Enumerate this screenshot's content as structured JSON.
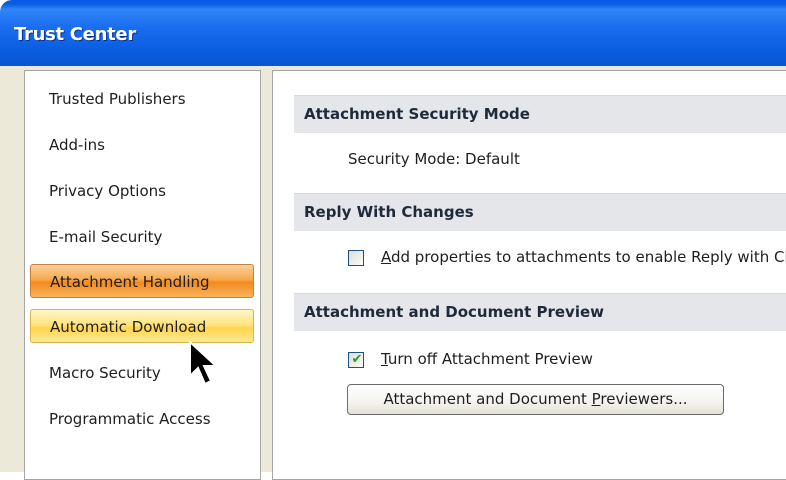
{
  "window": {
    "title": "Trust Center"
  },
  "sidebar": {
    "items": [
      {
        "label": "Trusted Publishers",
        "state": "normal"
      },
      {
        "label": "Add-ins",
        "state": "normal"
      },
      {
        "label": "Privacy Options",
        "state": "normal"
      },
      {
        "label": "E-mail Security",
        "state": "normal"
      },
      {
        "label": "Attachment Handling",
        "state": "selected"
      },
      {
        "label": "Automatic Download",
        "state": "hover"
      },
      {
        "label": "Macro Security",
        "state": "normal"
      },
      {
        "label": "Programmatic Access",
        "state": "normal"
      }
    ]
  },
  "main": {
    "security_mode": {
      "header": "Attachment Security Mode",
      "text": "Security Mode: Default"
    },
    "reply_changes": {
      "header": "Reply With Changes",
      "checkbox_access_key": "A",
      "checkbox_label_rest": "dd properties to attachments to enable Reply with Changes",
      "checked": false
    },
    "preview": {
      "header": "Attachment and Document Preview",
      "checkbox_access_key": "T",
      "checkbox_label_rest": "urn off Attachment Preview",
      "checked": true,
      "button_prefix": "Attachment and Document ",
      "button_access_key": "P",
      "button_suffix": "reviewers..."
    }
  },
  "colors": {
    "titlebar": "#0a5ce4",
    "selected_item": "#f48a1d",
    "hover_item": "#ffd449",
    "section_header_bg": "#e4e6ea"
  },
  "icons": {
    "cursor": "arrow-cursor-icon",
    "check": "check-mark-icon"
  }
}
